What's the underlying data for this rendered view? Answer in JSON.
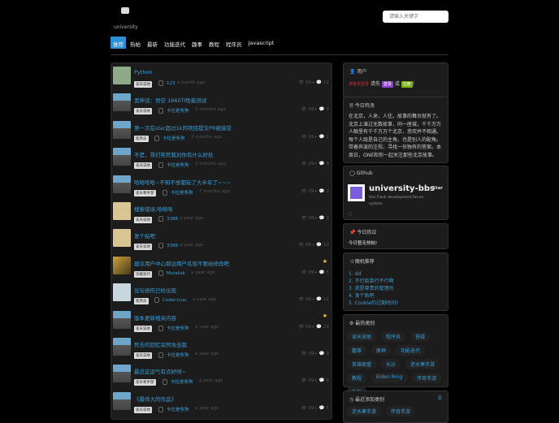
{
  "header": {
    "logo_text": "university",
    "search_placeholder": "请输入关键字"
  },
  "nav": [
    "推荐",
    "热帖",
    "最新",
    "功能迭代",
    "趣事",
    "教程",
    "程序员",
    "Javascript"
  ],
  "posts": [
    {
      "title": "Python",
      "tag": "谈天说地",
      "user": "123",
      "time": "a month ago",
      "views": "99+",
      "comments": "12",
      "avatar": "g",
      "star": false
    },
    {
      "title": "黑神话：悟空 1660TI性能测试",
      "tag": "谈天说地",
      "user": "卡拉是条狗",
      "time": "2 months ago",
      "views": "99+",
      "comments": "3",
      "avatar": "p",
      "star": false
    },
    {
      "title": "第一次在star超过1k的项目提交PR被接受",
      "tag": "程序员",
      "user": "卡拉是条狗",
      "time": "2 months ago",
      "views": "99+",
      "comments": "2",
      "avatar": "p",
      "star": false
    },
    {
      "title": "不是，哥们笑死我对你有什么好处",
      "tag": "谈天说地",
      "user": "卡拉是条狗",
      "time": "2 months ago",
      "views": "99+",
      "comments": "9",
      "avatar": "p",
      "star": false
    },
    {
      "title": "哈哈哈哈~不知不觉都玩了大半年了~~~",
      "tag": "逆水寒手游",
      "user": "卡拉是条狗",
      "time": "7 months ago",
      "views": "99+",
      "comments": "2",
      "avatar": "p",
      "star": false
    },
    {
      "title": "搜索错误,哈哈哈",
      "tag": "谈天说地",
      "user": "3388",
      "time": "a year ago",
      "views": "99+",
      "comments": "3",
      "avatar": "y",
      "star": false
    },
    {
      "title": "发个贴吧",
      "tag": "谈天说地",
      "user": "3388",
      "time": "a year ago",
      "views": "99+",
      "comments": "10",
      "avatar": "y",
      "star": false
    },
    {
      "title": "建议用户中心那边用户名就不要给修改吧",
      "tag": "功能迭代",
      "user": "Mutalisk",
      "time": "a year ago",
      "views": "99+",
      "comments": "5",
      "avatar": "a",
      "star": true
    },
    {
      "title": "论坛倍伤已检出现",
      "tag": "程序员",
      "user": "Coder-Liuu",
      "time": "a year ago",
      "views": "99+",
      "comments": "12",
      "avatar": "l",
      "star": false
    },
    {
      "title": "版本更新相关内容",
      "tag": "谈天说地",
      "user": "卡拉是条狗",
      "time": "a year ago",
      "views": "99+",
      "comments": "29",
      "avatar": "p",
      "star": true
    },
    {
      "title": "死去的回忆突然攻击我",
      "tag": "谈天说地",
      "user": "卡拉是条狗",
      "time": "a year ago",
      "views": "99+",
      "comments": "3",
      "avatar": "p",
      "star": false
    },
    {
      "title": "最近这运气有点好呀~",
      "tag": "逆水寒手游",
      "user": "卡拉是条狗",
      "time": "a year ago",
      "views": "99+",
      "comments": "6",
      "avatar": "p",
      "star": false
    },
    {
      "title": "《最伟大的作品》",
      "tag": "谈天说地",
      "user": "卡拉是条狗",
      "time": "a year ago",
      "views": "99+",
      "comments": "5",
      "avatar": "p",
      "star": false
    }
  ],
  "sidebar": {
    "user": {
      "title": "用户",
      "guest": "游客未登录",
      "prompt": "请先",
      "login": "登录",
      "or": "或",
      "register": "注册",
      "end": "!"
    },
    "soup": {
      "title": "今日鸡汤",
      "text": "在北京，人来，人往。故事的舞台就有了。北京上演过无数故事，同一座城，千千万万人眼里有千千万万个北京，悲欢并不相通。每个人既是自己的主角，也是别人的配角。带着奔波的注视，寻找一份独有的答案。本周日，ONE和你一起关注那些北京故事。"
    },
    "github": {
      "title": "Github",
      "repo": "university-bbs",
      "desc": "Use Flask development forum system.",
      "star": "Star"
    },
    "hot": {
      "title": "今日热议",
      "text": "今日暂无热帖!"
    },
    "random": {
      "title": "随机推荐",
      "items": [
        "1. dd",
        "2. 不打疫苗行不行啊",
        "3. 我是尊贵的管理员",
        "4. 发个贴吧",
        "5. Cookie的过期时间?"
      ]
    },
    "hot_categories": {
      "title": "最热类别",
      "items": [
        "谈天说地",
        "程序员",
        "答疑",
        "趣事",
        "原神",
        "功能迭代",
        "英雄联盟",
        "长沙",
        "逆水寒手游",
        "教程",
        "Elden Ring",
        "传奇手游",
        "外包"
      ]
    },
    "recent_categories": {
      "title": "最近添加类别",
      "items": [
        "逆水寒手游",
        "传奇手游"
      ]
    }
  }
}
